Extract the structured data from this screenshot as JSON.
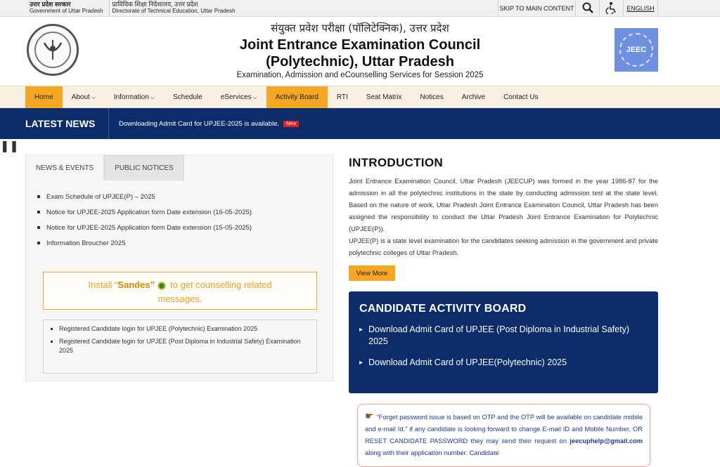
{
  "topbar": {
    "gov_hindi": "उत्तर प्रदेश सरकार",
    "gov_en": "Government of Uttar Pradesh",
    "dir_hindi": "प्राविधिक शिक्षा निदेशालय, उत्तर प्रदेश",
    "dir_en": "Directorate of Technical Education, Uttar Pradesh",
    "skip_label": "SKIP TO MAIN CONTENT",
    "search_icon": "search-icon",
    "access_icon": "accessibility-icon",
    "lang_label": "ENGLISH"
  },
  "header": {
    "hindi_title": "संयुक्त प्रवेश परीक्षा (पॉलिटेक्निक), उत्तर प्रदेश",
    "title_line1": "Joint Entrance Examination Council",
    "title_line2": "(Polytechnic), Uttar Pradesh",
    "subtitle": "Examination, Admission and eCounselling Services for Session 2025",
    "right_logo_text": "JEEC"
  },
  "nav": {
    "items": [
      {
        "label": "Home"
      },
      {
        "label": "About"
      },
      {
        "label": "Information"
      },
      {
        "label": "Schedule"
      },
      {
        "label": "eServices"
      },
      {
        "label": "Activity Board"
      },
      {
        "label": "RTI"
      },
      {
        "label": "Seat Matrix"
      },
      {
        "label": "Notices"
      },
      {
        "label": "Archive"
      },
      {
        "label": "Contact Us"
      }
    ]
  },
  "news": {
    "label": "LATEST NEWS",
    "message": "Downloading Admit Card for UPJEE-2025 is available.",
    "badge": "New"
  },
  "left": {
    "tab_news": "NEWS & EVENTS",
    "tab_notices": "PUBLIC NOTICES",
    "news_items": [
      "Exam Schedule of UPJEE(P) – 2025",
      "Notice for UPJEE-2025 Application form Date extension (16-05-2025)",
      "Notice for UPJEE-2025 Application form Date extension (15-05-2025)",
      "Information Broucher 2025"
    ],
    "sandes_pre": "Install “",
    "sandes_name": "Sandes”",
    "sandes_post": "to get counselling related",
    "sandes_post2": "messages.",
    "candidate_links": [
      "Registered Candidate login for UPJEE (Polytechnic) Examination 2025",
      "Registered Candidate login for UPJEE (Post Diploma in Industrial Safety) Examination 2025"
    ]
  },
  "intro": {
    "heading": "INTRODUCTION",
    "para1": "Joint Entrance Examination Council, Uttar Pradesh (JEECUP) was formed in the year 1986-87 for the admission in all the polytechnic institutions in the state by conducting admission test at the state level. Based on the nature of work, Uttar Pradesh Joint Entrance Examination Council, Uttar Pradesh has been assigned the responsibility to conduct the Uttar Pradesh Joint Entrance Examination for Polytechnic (UPJEE(P)).",
    "para2": "UPJEE(P) is a state level examination for the candidates seeking admission in the government and private polytechnic colleges of Uttar Pradesh.",
    "view_more": "View More"
  },
  "board": {
    "heading": "CANDIDATE ACTIVITY BOARD",
    "items": [
      "Download Admit Card of UPJEE (Post Diploma in Industrial Safety) 2025",
      "Download Admit Card of UPJEE(Polytechnic) 2025"
    ]
  },
  "notice": {
    "text1": "“Forget password issue is based on OTP and the OTP will be available on candidate mobile and e-mail Id.” if any candidate is looking forward to change E-mail ID and Mobile Number, OR RESET CANDIDATE PASSWORD they may send their request on ",
    "email": "jeecuphelp@gmail.com",
    "text2": " along with their application number. Candidate"
  }
}
